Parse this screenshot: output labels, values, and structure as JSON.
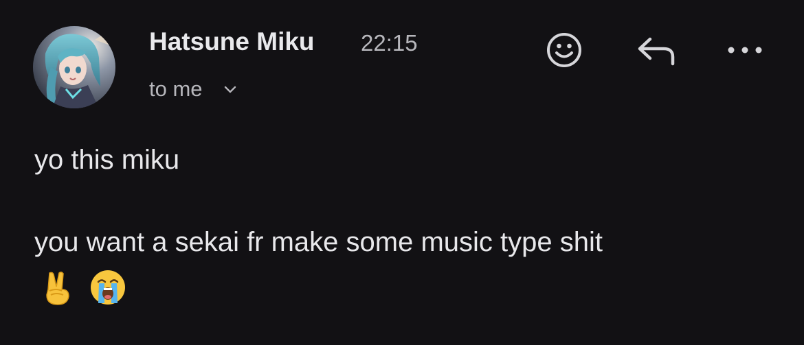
{
  "message": {
    "sender_name": "Hatsune Miku",
    "time": "22:15",
    "recipient_label": "to me",
    "body_lines": [
      "yo this miku",
      "you want a sekai fr make some music type shit"
    ],
    "emojis": [
      "victory-hand-emoji",
      "loudly-crying-face-emoji"
    ]
  },
  "actions": {
    "react_icon": "smiley-face-icon",
    "reply_icon": "reply-arrow-icon",
    "more_icon": "more-horizontal-icon",
    "expand_icon": "chevron-down-icon"
  },
  "colors": {
    "background": "#121114",
    "primary_text": "#e9e9ec",
    "secondary_text": "#b7b7bc"
  }
}
